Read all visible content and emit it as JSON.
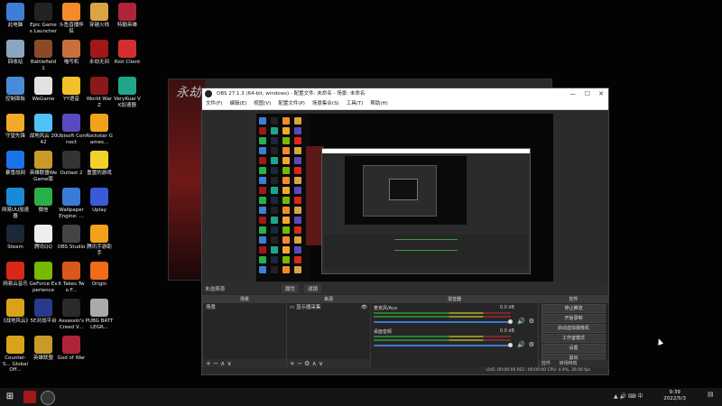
{
  "desktop": {
    "icons": [
      {
        "label": "此电脑",
        "color": "#3d7fd6",
        "col": 0,
        "row": 0
      },
      {
        "label": "Epic Games Launcher",
        "color": "#222",
        "col": 1,
        "row": 0
      },
      {
        "label": "斗鱼直播伴侣",
        "color": "#f58a2a",
        "col": 2,
        "row": 0
      },
      {
        "label": "穿越火线",
        "color": "#d9a441",
        "col": 3,
        "row": 0
      },
      {
        "label": "特勤英雄",
        "color": "#b0243a",
        "col": 4,
        "row": 0
      },
      {
        "label": "回收站",
        "color": "#8ba4c0",
        "col": 0,
        "row": 1
      },
      {
        "label": "Battlefield 1",
        "color": "#8a4a2a",
        "col": 1,
        "row": 1
      },
      {
        "label": "喵写机",
        "color": "#c96f3d",
        "col": 2,
        "row": 1
      },
      {
        "label": "永劫无间",
        "color": "#a01818",
        "col": 3,
        "row": 1
      },
      {
        "label": "Riot Client",
        "color": "#d32f2f",
        "col": 4,
        "row": 1
      },
      {
        "label": "控制面板",
        "color": "#4a8bd8",
        "col": 0,
        "row": 2
      },
      {
        "label": "WeGame",
        "color": "#e2e2e2",
        "col": 1,
        "row": 2
      },
      {
        "label": "YY语音",
        "color": "#f4c02a",
        "col": 2,
        "row": 2
      },
      {
        "label": "World War Z",
        "color": "#8a1a1a",
        "col": 3,
        "row": 2
      },
      {
        "label": "VeryKuai VK加速器",
        "color": "#1fa68a",
        "col": 4,
        "row": 2
      },
      {
        "label": "守望先锋",
        "color": "#f2a92a",
        "col": 0,
        "row": 3
      },
      {
        "label": "战地风云 2042",
        "color": "#4fc3f7",
        "col": 1,
        "row": 3
      },
      {
        "label": "Ubisoft Connect",
        "color": "#5a4ac0",
        "col": 2,
        "row": 3
      },
      {
        "label": "Rockstar Games...",
        "color": "#f2a21a",
        "col": 3,
        "row": 3
      },
      {
        "label": "暴雪战网",
        "color": "#1a73e8",
        "col": 0,
        "row": 4
      },
      {
        "label": "英雄联盟WeGame版",
        "color": "#c99a2a",
        "col": 1,
        "row": 4
      },
      {
        "label": "Outlast 2",
        "color": "#333",
        "col": 2,
        "row": 4
      },
      {
        "label": "重置的游戏",
        "color": "#f2d22a",
        "col": 3,
        "row": 4
      },
      {
        "label": "网易UU加速器",
        "color": "#1a8ad8",
        "col": 0,
        "row": 5
      },
      {
        "label": "微信",
        "color": "#2ab04a",
        "col": 1,
        "row": 5
      },
      {
        "label": "Wallpaper Engine: ...",
        "color": "#3a7ad8",
        "col": 2,
        "row": 5
      },
      {
        "label": "Uplay",
        "color": "#3a5ad8",
        "col": 3,
        "row": 5
      },
      {
        "label": "Steam",
        "color": "#1b2838",
        "col": 0,
        "row": 6
      },
      {
        "label": "腾讯QQ",
        "color": "#eee",
        "col": 1,
        "row": 6
      },
      {
        "label": "OBS Studio",
        "color": "#444",
        "col": 2,
        "row": 6
      },
      {
        "label": "腾讯手游助手",
        "color": "#f2a21a",
        "col": 3,
        "row": 6
      },
      {
        "label": "网易云音乐",
        "color": "#d8281a",
        "col": 0,
        "row": 7
      },
      {
        "label": "GeForce Experience",
        "color": "#76b900",
        "col": 1,
        "row": 7
      },
      {
        "label": "It Takes Two F...",
        "color": "#d8571a",
        "col": 2,
        "row": 7
      },
      {
        "label": "Origin",
        "color": "#f26a1a",
        "col": 3,
        "row": 7
      },
      {
        "label": "《战地风云》",
        "color": "#d8a21a",
        "col": 0,
        "row": 8
      },
      {
        "label": "5E对战平台",
        "color": "#2a3a8a",
        "col": 1,
        "row": 8
      },
      {
        "label": "Assassin's Creed V...",
        "color": "#2a2a2a",
        "col": 2,
        "row": 8
      },
      {
        "label": "PUBG BATTLEGR...",
        "color": "#aaa",
        "col": 3,
        "row": 8
      },
      {
        "label": "Counter-S... Global Off...",
        "color": "#d8a21a",
        "col": 0,
        "row": 9
      },
      {
        "label": "英雄联盟",
        "color": "#c99a2a",
        "col": 1,
        "row": 9
      },
      {
        "label": "God of War",
        "color": "#b0243a",
        "col": 2,
        "row": 9
      }
    ]
  },
  "background_window": {
    "title_glyph": "永劫"
  },
  "obs": {
    "title": "OBS 27.1.3 (64-bit, windows) - 配置文件: 未命名 - 场景: 未命名",
    "controls": {
      "min": "—",
      "max": "☐",
      "close": "✕"
    },
    "menu": [
      "文件(F)",
      "编辑(E)",
      "视图(V)",
      "配置文件(P)",
      "场景集合(S)",
      "工具(T)",
      "帮助(H)"
    ],
    "toolrow": {
      "source_label": "未选择源",
      "props": "属性",
      "filters": "滤镜"
    },
    "docks": {
      "scenes": {
        "header": "场景",
        "items": [
          "场景"
        ],
        "footer": "+ − ∧ ∨"
      },
      "sources": {
        "header": "来源",
        "items": [
          "显示器采集"
        ],
        "footer": "+ − ⚙ ∧ ∨"
      },
      "mixer": {
        "header": "混音器",
        "rows": [
          {
            "name": "麦克风/Aux",
            "db": "0.0 dB"
          },
          {
            "name": "桌面音频",
            "db": "0.0 dB"
          }
        ]
      },
      "controls": {
        "header": "控件",
        "buttons": [
          "停止推流",
          "开始录制",
          "启动虚拟摄像机",
          "工作室模式",
          "设置",
          "退出"
        ],
        "tabs": [
          "控件",
          "转场特效"
        ]
      }
    },
    "status": "LIVE: 00:00:00   REC: 00:00:00   CPU: 4.9%, 30.00 fps"
  },
  "taskbar": {
    "time": "9:39",
    "date": "2022/5/3",
    "lang": "中"
  }
}
